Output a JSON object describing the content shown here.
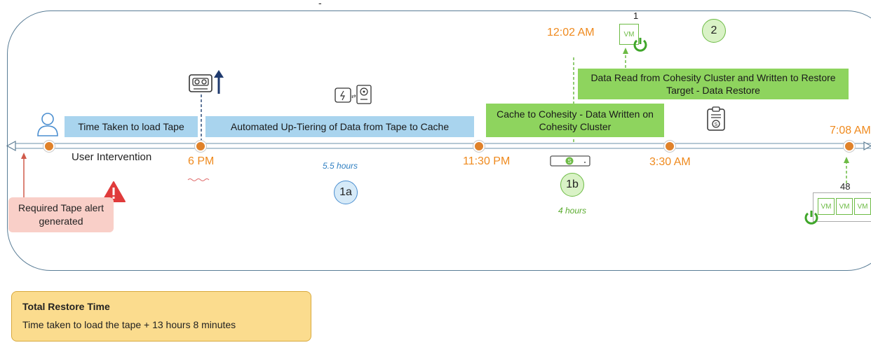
{
  "labels": {
    "time_to_load": "Time Taken to load Tape",
    "up_tiering": "Automated Up-Tiering of Data from Tape to Cache",
    "cache_to_cohesity": "Cache to Cohesity - Data Written on Cohesity Cluster",
    "data_read": "Data Read from Cohesity Cluster  and Written to Restore Target - Data Restore",
    "user_intervention": "User Intervention",
    "required_tape": "Required Tape alert generated",
    "top_tick": "-"
  },
  "times": {
    "t1": "6 PM",
    "t2": "11:30 PM",
    "t3": "12:02 AM",
    "t4": "3:30 AM",
    "t5": "7:08 AM"
  },
  "durations": {
    "phase_1a": "5.5 hours",
    "phase_1b": "4 hours"
  },
  "steps": {
    "s1a": "1a",
    "s1b": "1b",
    "s2": "2"
  },
  "vm": {
    "single_count": "1",
    "multi_count": "48",
    "label": "VM"
  },
  "total": {
    "title": "Total Restore Time",
    "text": "Time taken to load the tape + 13 hours 8 minutes"
  },
  "colors": {
    "orange": "#ef8a1e",
    "blue_box": "#a9d4ee",
    "green_box": "#8ed45e",
    "alert_red": "#e03b3b",
    "total_bg": "#fbdc8e"
  },
  "icons": [
    "user-icon",
    "tape-icon",
    "up-arrow-icon",
    "tape-drive-icon",
    "clipboard-icon",
    "warning-icon",
    "cohesity-device-icon",
    "power-icon"
  ]
}
